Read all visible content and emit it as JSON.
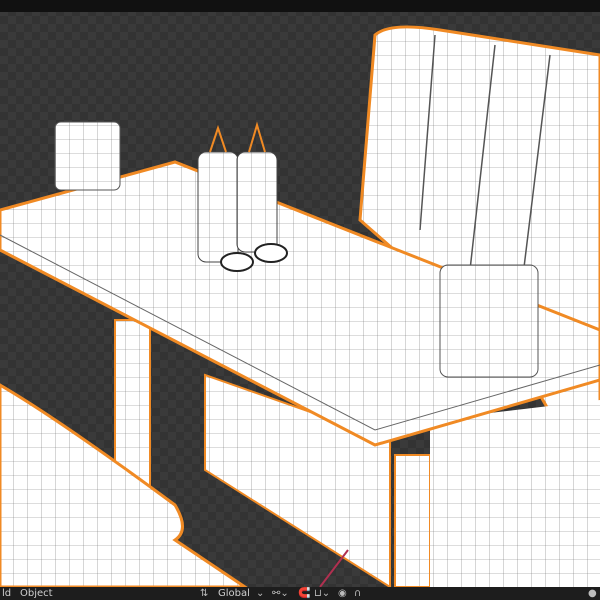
{
  "header_menu": {
    "view_label": "ld",
    "object_label": "Object"
  },
  "toolbar": {
    "orientation_label": "Global",
    "orientation_icon": "transform-orientation-icon",
    "pivot_icon": "pivot-icon",
    "snap_icon": "snap-icon",
    "proportional_icon": "proportional-edit-icon"
  },
  "colors": {
    "selection_outline": "#f08a24",
    "mesh": "#ffffff",
    "wire": "#555555",
    "background": "#3a3a3a"
  }
}
